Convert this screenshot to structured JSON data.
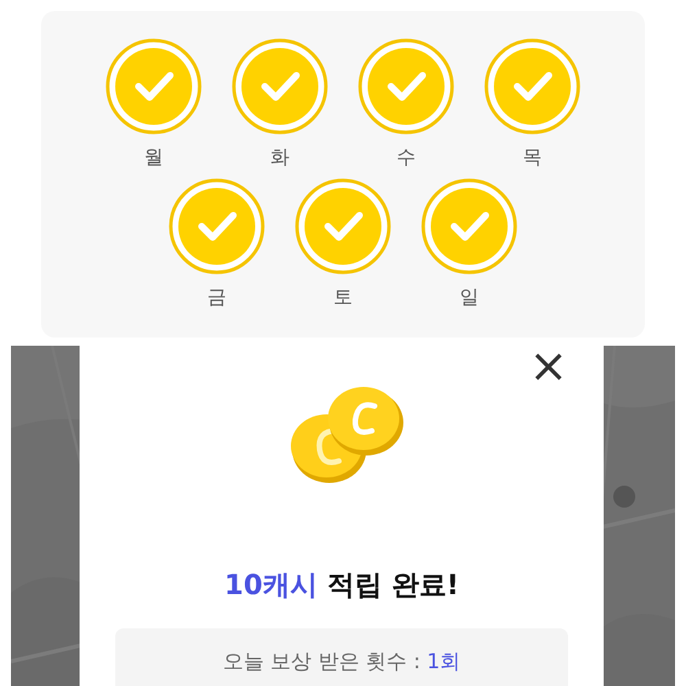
{
  "attendance": {
    "days": [
      {
        "label": "월",
        "checked": true
      },
      {
        "label": "화",
        "checked": true
      },
      {
        "label": "수",
        "checked": true
      },
      {
        "label": "목",
        "checked": true
      },
      {
        "label": "금",
        "checked": true
      },
      {
        "label": "토",
        "checked": true
      },
      {
        "label": "일",
        "checked": true
      }
    ]
  },
  "dialog": {
    "close": "×",
    "amount": "10캐시",
    "title": "적립 완료!",
    "count_label": "오늘 보상 받은 횟수 :",
    "count_value": "1회"
  }
}
